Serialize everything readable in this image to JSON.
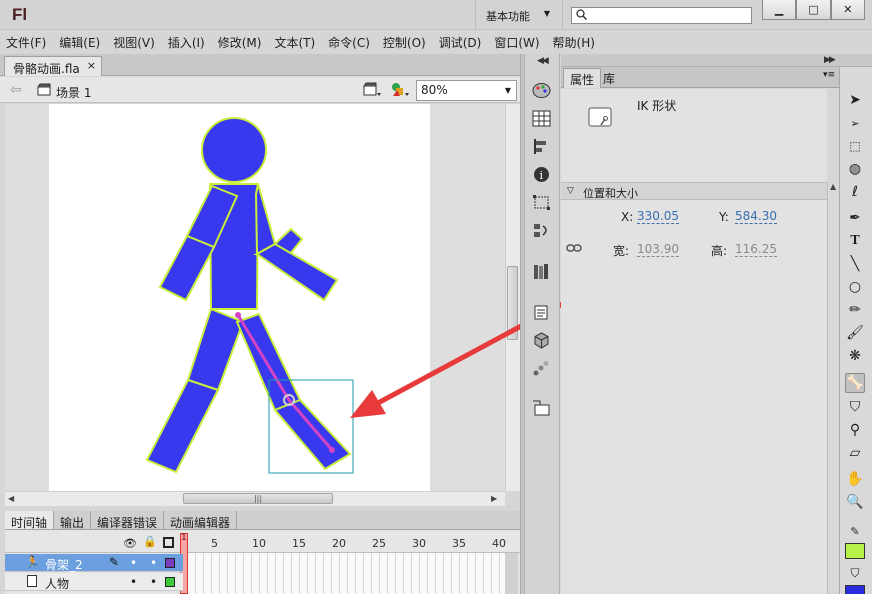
{
  "titlebar": {
    "logo": "Fl",
    "workspace": "基本功能",
    "search": {
      "value": "",
      "placeholder": ""
    }
  },
  "menu": [
    "文件(F)",
    "编辑(E)",
    "视图(V)",
    "插入(I)",
    "修改(M)",
    "文本(T)",
    "命令(C)",
    "控制(O)",
    "调试(D)",
    "窗口(W)",
    "帮助(H)"
  ],
  "document": {
    "tab_name": "骨骼动画.fla",
    "close": "×",
    "scene": "场景 1",
    "zoom": "80%"
  },
  "timeline": {
    "tabs": [
      "时间轴",
      "输出",
      "编译器错误",
      "动画编辑器"
    ],
    "frame_numbers": [
      "1",
      "5",
      "10",
      "15",
      "20",
      "25",
      "30",
      "35",
      "40"
    ],
    "layers": [
      {
        "name": "骨架_2",
        "color": "#7a3fbf",
        "selected": true
      },
      {
        "name": "人物",
        "color": "#3ec83e",
        "selected": false
      }
    ]
  },
  "properties": {
    "tabs": [
      "属性",
      "库"
    ],
    "object_name": "IK 形状",
    "section": "位置和大小",
    "x_label": "X:",
    "x_value": "330.05",
    "y_label": "Y:",
    "y_value": "584.30",
    "w_label": "宽:",
    "w_value": "103.90",
    "h_label": "高:",
    "h_value": "116.25"
  },
  "colors": {
    "figure_fill": "#3838ee",
    "figure_outline": "#c9ef3a",
    "bone": "#d444c4",
    "arrow": "#e83a3a",
    "stroke_swatch": "#b8f04a",
    "fill_swatch": "#2b2be0"
  }
}
